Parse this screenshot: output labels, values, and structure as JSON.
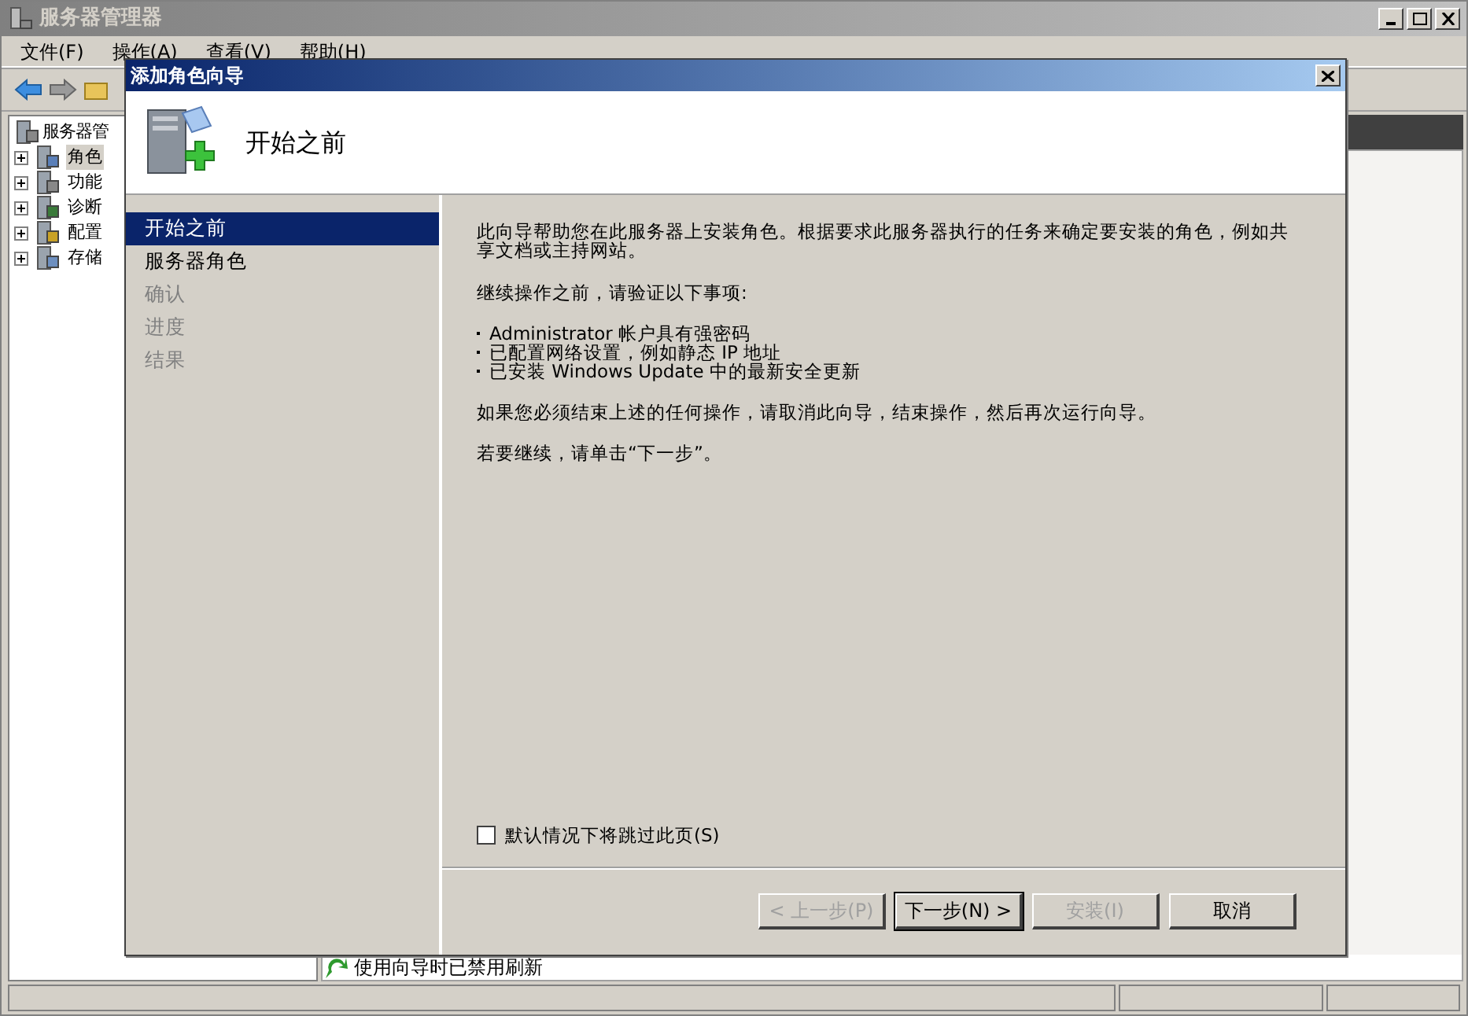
{
  "window": {
    "title": "服务器管理器"
  },
  "menu": [
    "文件(F)",
    "操作(A)",
    "查看(V)",
    "帮助(H)"
  ],
  "tree": {
    "root": "服务器管",
    "items": [
      {
        "label": "角色",
        "selected": true
      },
      {
        "label": "功能",
        "selected": false
      },
      {
        "label": "诊断",
        "selected": false
      },
      {
        "label": "配置",
        "selected": false
      },
      {
        "label": "存储",
        "selected": false
      }
    ]
  },
  "background_notice": "使用向导时已禁用刷新",
  "dialog": {
    "title": "添加角色向导",
    "heading": "开始之前",
    "steps": [
      {
        "label": "开始之前",
        "selected": true,
        "disabled": false
      },
      {
        "label": "服务器角色",
        "selected": false,
        "disabled": false
      },
      {
        "label": "确认",
        "selected": false,
        "disabled": true
      },
      {
        "label": "进度",
        "selected": false,
        "disabled": true
      },
      {
        "label": "结果",
        "selected": false,
        "disabled": true
      }
    ],
    "intro": "此向导帮助您在此服务器上安装角色。根据要求此服务器执行的任务来确定要安装的角色，例如共享文档或主持网站。",
    "verify_title": "继续操作之前，请验证以下事项:",
    "bullets": [
      "Administrator 帐户具有强密码",
      "已配置网络设置，例如静态 IP 地址",
      "已安装 Windows Update 中的最新安全更新"
    ],
    "cancel_note": "如果您必须结束上述的任何操作，请取消此向导，结束操作，然后再次运行向导。",
    "continue_note": "若要继续，请单击“下一步”。",
    "skip_checkbox": {
      "label": "默认情况下将跳过此页(S)",
      "checked": false
    },
    "buttons": [
      {
        "label": "< 上一步(P)",
        "disabled": true,
        "default": false
      },
      {
        "label": "下一步(N) >",
        "disabled": false,
        "default": true
      },
      {
        "label": "安装(I)",
        "disabled": true,
        "default": false
      },
      {
        "label": "取消",
        "disabled": false,
        "default": false
      }
    ]
  }
}
